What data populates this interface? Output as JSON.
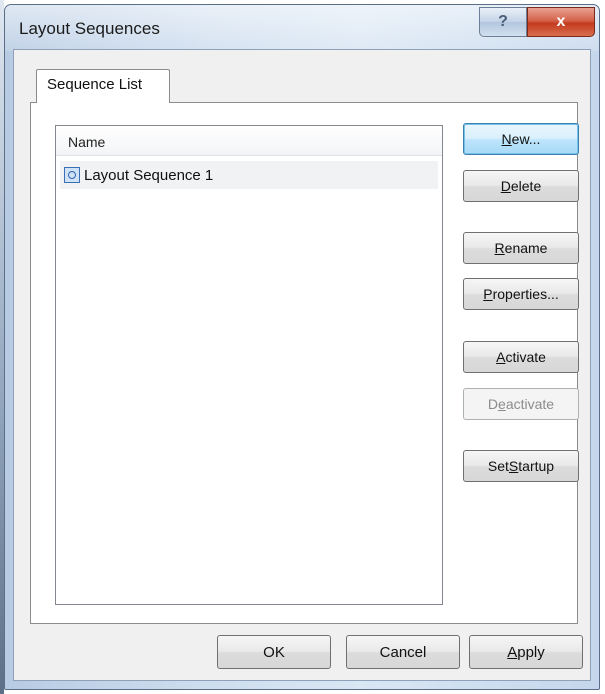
{
  "window": {
    "title": "Layout Sequences",
    "help_label": "?",
    "close_label": "x"
  },
  "tabs": [
    {
      "label": "Sequence List",
      "selected": true
    }
  ],
  "list": {
    "column_header": "Name",
    "items": [
      {
        "label": "Layout Sequence 1",
        "icon": "layout-sequence-icon"
      }
    ]
  },
  "buttons": {
    "new": {
      "before": "",
      "mnemonic": "N",
      "after": "ew..."
    },
    "delete": {
      "before": "",
      "mnemonic": "D",
      "after": "elete"
    },
    "rename": {
      "before": "",
      "mnemonic": "R",
      "after": "ename"
    },
    "properties": {
      "before": "",
      "mnemonic": "P",
      "after": "roperties..."
    },
    "activate": {
      "before": "",
      "mnemonic": "A",
      "after": "ctivate"
    },
    "deactivate": {
      "before": "D",
      "mnemonic": "e",
      "after": "activate",
      "disabled": true
    },
    "set_startup": {
      "before": "Set ",
      "mnemonic": "S",
      "after": "tartup"
    }
  },
  "footer": {
    "ok": "OK",
    "cancel": "Cancel",
    "apply": {
      "before": "",
      "mnemonic": "A",
      "after": "pply"
    }
  },
  "colors": {
    "default_button_border": "#3c7fb1",
    "close_button": "#c43a1f",
    "titlebar": "#cfdeef"
  }
}
